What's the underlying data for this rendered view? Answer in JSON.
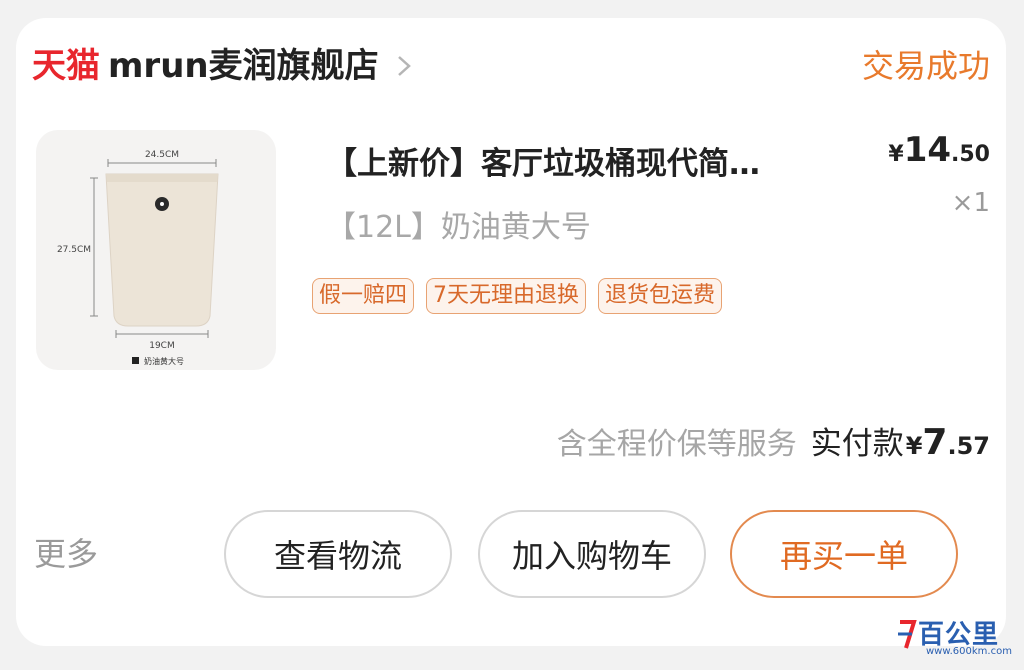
{
  "shop": {
    "platform_logo": "天猫",
    "name": "mrun麦润旗舰店",
    "chevron_icon": "chevron-right-icon"
  },
  "order": {
    "status": "交易成功"
  },
  "product": {
    "image_dims": {
      "width": "24.5CM",
      "height": "27.5CM",
      "base": "19CM",
      "swatch_label": "奶油黄大号"
    },
    "title": "【上新价】客厅垃圾桶现代简…",
    "variant": "【12L】奶油黄大号",
    "price": {
      "currency": "¥",
      "integer": "14",
      "decimal": ".50"
    },
    "quantity": "×1",
    "tags": [
      "假一赔四",
      "7天无理由退换",
      "退货包运费"
    ]
  },
  "payment": {
    "service_note": "含全程价保等服务",
    "label": "实付款",
    "currency": "¥",
    "integer": "7",
    "decimal": ".57"
  },
  "actions": {
    "more": "更多",
    "logistics": "查看物流",
    "add_to_cart": "加入购物车",
    "rebuy": "再买一单"
  },
  "watermark": {
    "text": "百公里",
    "url": "www.600km.com"
  },
  "colors": {
    "tmall_red": "#e8262d",
    "accent_orange": "#e87a2c",
    "tag_border": "#e8a373",
    "muted": "#a6a6a6"
  }
}
